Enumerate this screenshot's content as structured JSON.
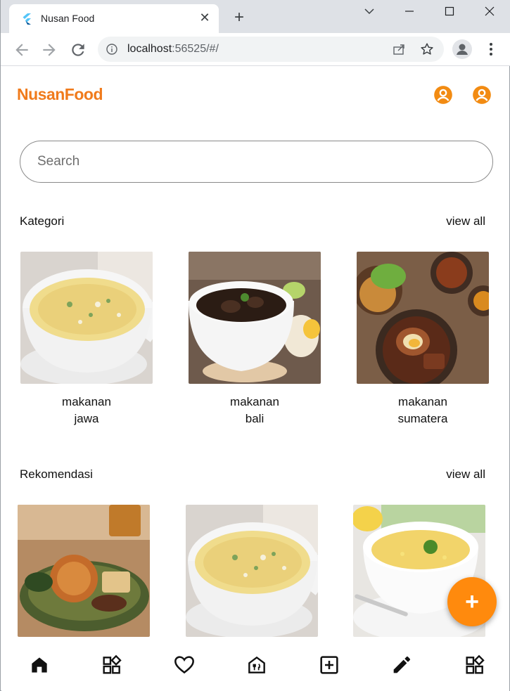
{
  "browser": {
    "tab_title": "Nusan Food",
    "tab_close": "✕",
    "new_tab": "+",
    "url_host": "localhost",
    "url_rest": ":56525/#/"
  },
  "app": {
    "brand": "NusanFood",
    "brand_color": "#f07b1c",
    "accent_color": "#ff8a0d",
    "search": {
      "placeholder": "Search",
      "value": ""
    },
    "kategori": {
      "title": "Kategori",
      "view_all": "view all",
      "items": [
        {
          "label": "makanan\njawa",
          "image": "soup-bowl"
        },
        {
          "label": "makanan\nbali",
          "image": "beef-black-soup"
        },
        {
          "label": "makanan\nsumatera",
          "image": "braised-dishes"
        }
      ]
    },
    "rekomendasi": {
      "title": "Rekomendasi",
      "view_all": "view all",
      "items": [
        {
          "image": "rice-plate"
        },
        {
          "image": "soup-bowl"
        },
        {
          "image": "corn-soup"
        }
      ]
    },
    "fab_label": "+",
    "bottom_nav": [
      {
        "icon": "home-icon"
      },
      {
        "icon": "category-icon"
      },
      {
        "icon": "heart-icon"
      },
      {
        "icon": "restaurant-icon"
      },
      {
        "icon": "add-box-icon"
      },
      {
        "icon": "edit-icon"
      },
      {
        "icon": "category-icon"
      }
    ]
  }
}
